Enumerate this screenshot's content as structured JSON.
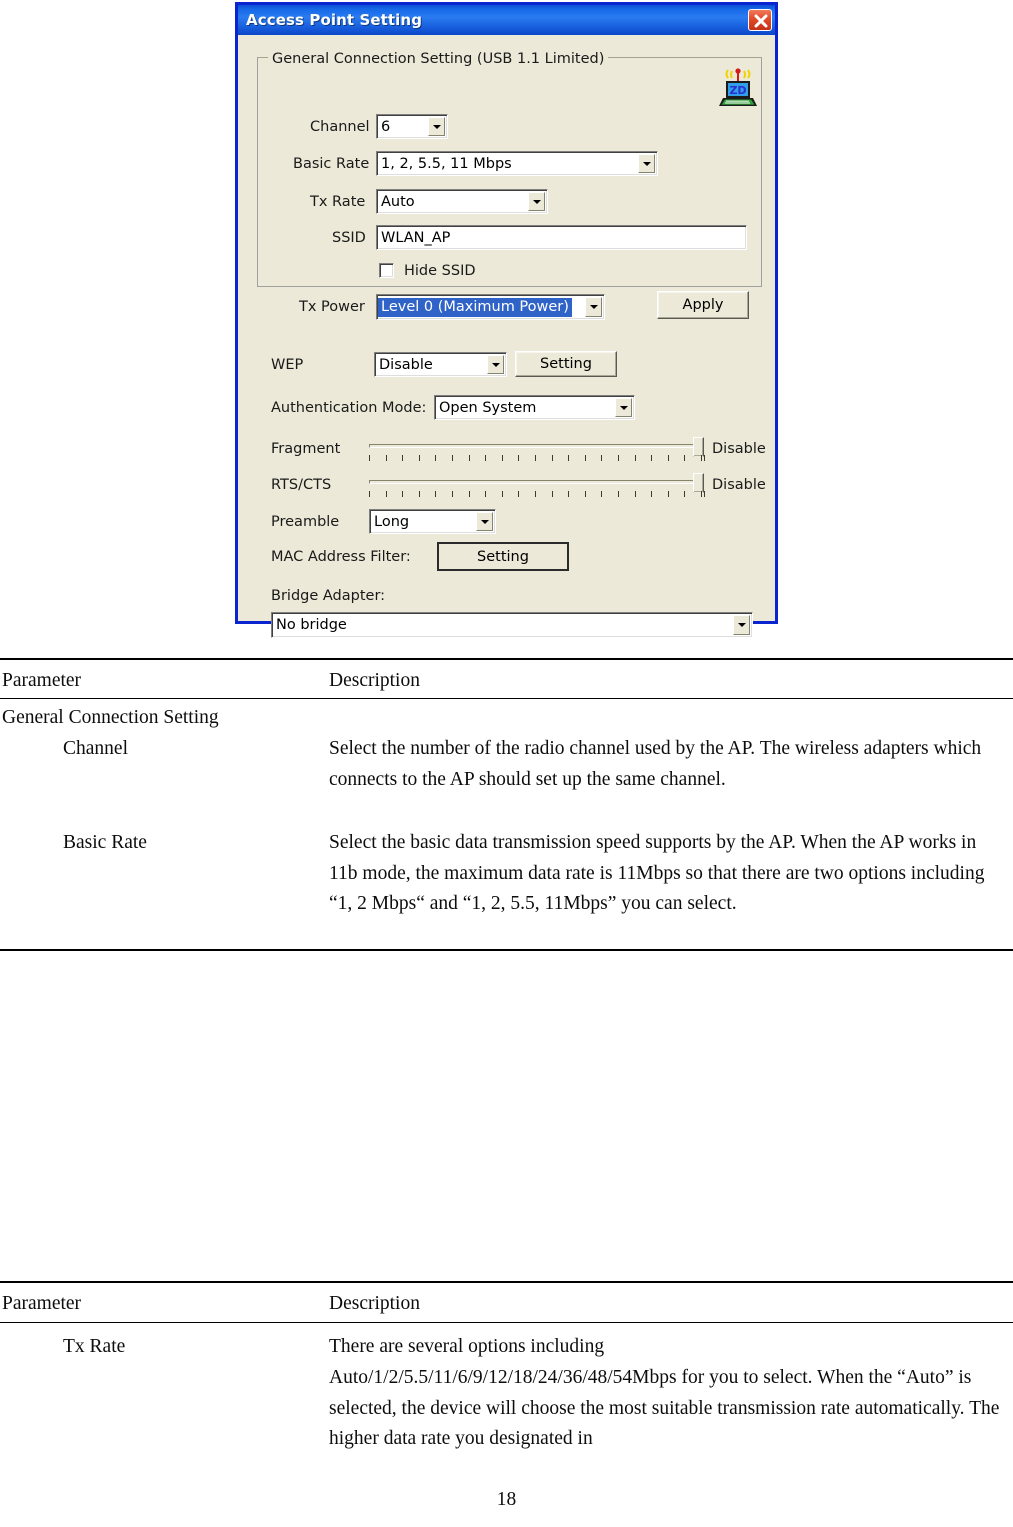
{
  "dialog": {
    "title": "Access Point Setting",
    "close_icon": "close-icon",
    "logo_icon": "zd-wireless-laptop-logo",
    "logo_text": "ZD",
    "group": {
      "legend": "General Connection Setting (USB 1.1 Limited)",
      "fields": {
        "channel_label": "Channel",
        "channel_value": "6",
        "basic_rate_label": "Basic Rate",
        "basic_rate_value": "1, 2, 5.5, 11 Mbps",
        "tx_rate_label": "Tx Rate",
        "tx_rate_value": "Auto",
        "ssid_label": "SSID",
        "ssid_value": "WLAN_AP",
        "hide_ssid_label": "Hide SSID",
        "hide_ssid_checked": false,
        "tx_power_label": "Tx Power",
        "tx_power_value": "Level 0 (Maximum Power)",
        "apply_label": "Apply"
      }
    },
    "wep_label": "WEP",
    "wep_value": "Disable",
    "wep_setting_label": "Setting",
    "auth_mode_label": "Authentication Mode:",
    "auth_mode_value": "Open System",
    "fragment_label": "Fragment",
    "fragment_value": "Disable",
    "rts_cts_label": "RTS/CTS",
    "rts_cts_value": "Disable",
    "preamble_label": "Preamble",
    "preamble_value": "Long",
    "mac_filter_label": "MAC Address Filter:",
    "mac_filter_setting_label": "Setting",
    "bridge_adapter_label": "Bridge Adapter:",
    "bridge_adapter_value": "No bridge"
  },
  "document": {
    "table1": {
      "header_parameter": "Parameter",
      "header_description": "Description",
      "section": "General Connection Setting",
      "rows": [
        {
          "parameter": "Channel",
          "description": "Select the number of the radio channel used by the AP. The wireless adapters which connects to the AP should set up the same channel."
        },
        {
          "parameter": "Basic Rate",
          "description": "Select the basic data transmission speed supports by the AP. When the AP works in 11b mode, the maximum data rate is 11Mbps so that there are two options including “1, 2 Mbps“ and “1, 2, 5.5, 11Mbps” you can select."
        }
      ]
    },
    "table2": {
      "header_parameter": "Parameter",
      "header_description": "Description",
      "rows": [
        {
          "parameter": "Tx Rate",
          "description_line1": "There are several options including",
          "description_rest": "Auto/1/2/5.5/11/6/9/12/18/24/36/48/54Mbps for you to select. When the “Auto” is selected, the device will choose the most suitable transmission rate automatically. The higher data rate you designated in"
        }
      ]
    },
    "page_number": "18"
  }
}
